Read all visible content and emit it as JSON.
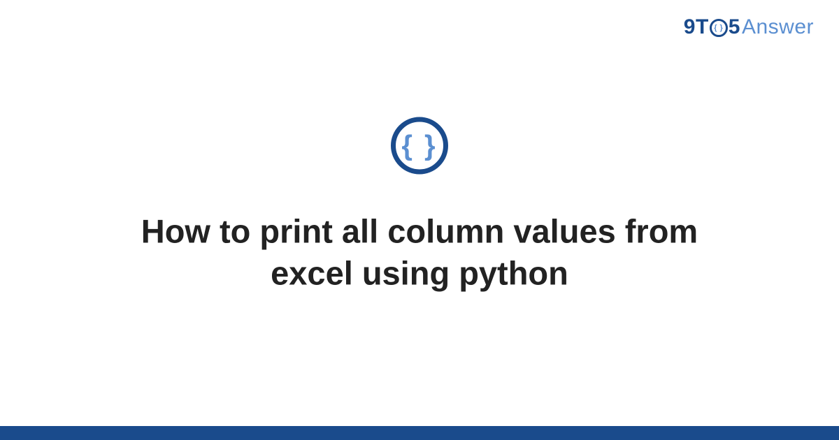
{
  "brand": {
    "part_nine": "9",
    "part_t": "T",
    "part_o_inner": "{ }",
    "part_five": "5",
    "part_answer": "Answer"
  },
  "topic_icon_glyph": "{ }",
  "title": "How to print all column values from excel using python"
}
